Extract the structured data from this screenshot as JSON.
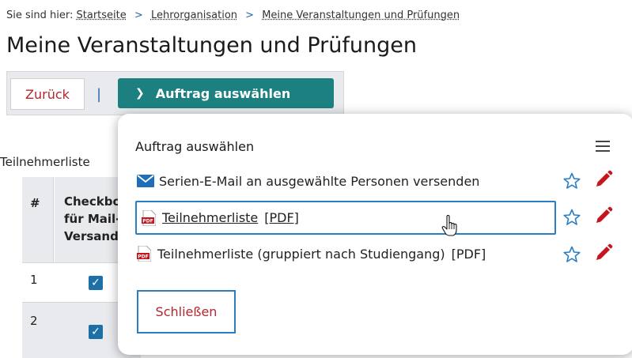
{
  "breadcrumb": {
    "prefix": "Sie sind hier:",
    "items": [
      "Startseite",
      "Lehrorganisation",
      "Meine Veranstaltungen und Prüfungen"
    ],
    "separator": ">"
  },
  "page_title": "Meine Veranstaltungen und Prüfungen",
  "toolbar": {
    "back_label": "Zurück",
    "separator": "|",
    "order_select_label": "Auftrag auswählen"
  },
  "partial_label": "Teilnehmerliste",
  "table": {
    "headers": {
      "hash": "#",
      "checkbox": "Checkbox für Mail-Versand"
    },
    "rows": [
      {
        "num": "1",
        "checked": true
      },
      {
        "num": "2",
        "checked": true
      }
    ]
  },
  "popup": {
    "title": "Auftrag auswählen",
    "items": [
      {
        "icon": "mail-icon",
        "label": "Serien-E-Mail an ausgewählte Personen versenden",
        "format": ""
      },
      {
        "icon": "pdf-icon",
        "label": "Teilnehmerliste",
        "format": "[PDF]"
      },
      {
        "icon": "pdf-icon",
        "label": "Teilnehmerliste (gruppiert nach Studiengang)",
        "format": "[PDF]"
      }
    ],
    "close_label": "Schließen"
  },
  "colors": {
    "accent_teal": "#1d8080",
    "link_red": "#b5262e",
    "focus_blue": "#2a7ec4",
    "pencil_red": "#c4161c"
  }
}
